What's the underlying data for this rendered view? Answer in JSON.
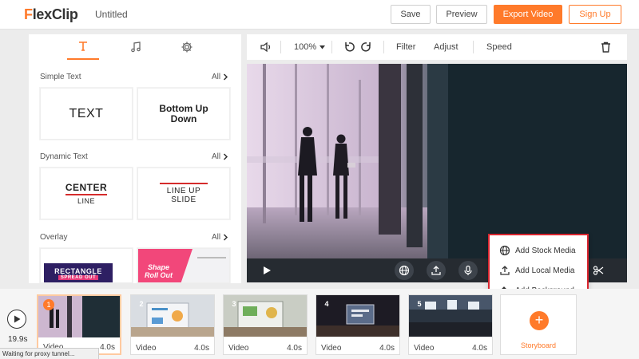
{
  "header": {
    "logo_prefix": "F",
    "logo_rest": "lexClip",
    "title": "Untitled",
    "save_label": "Save",
    "preview_label": "Preview",
    "export_label": "Export Video",
    "signup_label": "Sign Up"
  },
  "colors": {
    "accent": "#ff7a2a",
    "highlight": "#d9252e",
    "controls_bg": "#262b31"
  },
  "panel": {
    "tabs": [
      {
        "icon": "text-icon",
        "active": true
      },
      {
        "icon": "music-icon",
        "active": false
      },
      {
        "icon": "gear-icon",
        "active": false
      }
    ],
    "sections": [
      {
        "title": "Simple Text",
        "all": "All",
        "cards": [
          "TEXT",
          "Bottom Up Down"
        ]
      },
      {
        "title": "Dynamic Text",
        "all": "All",
        "cards": [
          {
            "main": "CENTER",
            "sub": "LINE"
          },
          {
            "main": "LINE UP",
            "sub": "SLIDE"
          }
        ]
      },
      {
        "title": "Overlay",
        "all": "All",
        "cards": [
          {
            "main": "RECTANGLE",
            "sub": "SPREAD OUT"
          },
          {
            "main": "Shape",
            "sub": "Roll Out"
          }
        ]
      }
    ]
  },
  "toolbar": {
    "zoom": "100%",
    "filter": "Filter",
    "adjust": "Adjust",
    "speed": "Speed"
  },
  "popup": {
    "items": [
      "Add Stock Media",
      "Add Local Media",
      "Add Background"
    ]
  },
  "timeline": {
    "total": "19.9s",
    "clips": [
      {
        "num": "1",
        "type": "Video",
        "dur": "4.0s"
      },
      {
        "num": "2",
        "type": "Video",
        "dur": "4.0s"
      },
      {
        "num": "3",
        "type": "Video",
        "dur": "4.0s"
      },
      {
        "num": "4",
        "type": "Video",
        "dur": "4.0s"
      },
      {
        "num": "5",
        "type": "Video",
        "dur": "4.0s"
      }
    ],
    "storyboard_label": "Storyboard"
  },
  "status": "Waiting for proxy tunnel..."
}
